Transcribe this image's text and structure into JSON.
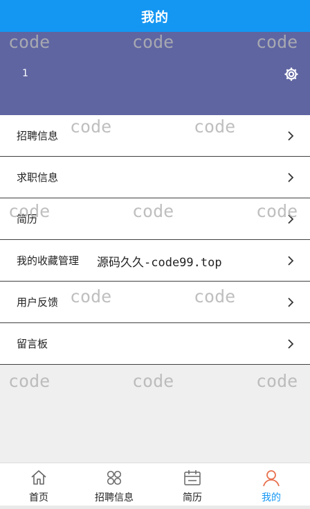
{
  "header": {
    "title": "我的"
  },
  "profile": {
    "username": "1",
    "settings_icon": "gear-icon"
  },
  "menu": {
    "items": [
      {
        "label": "招聘信息",
        "icon": "chevron-right-icon"
      },
      {
        "label": "求职信息",
        "icon": "chevron-right-icon"
      },
      {
        "label": "简历",
        "icon": "chevron-right-icon"
      },
      {
        "label": "我的收藏管理",
        "icon": "chevron-right-icon"
      },
      {
        "label": "用户反馈",
        "icon": "chevron-right-icon"
      },
      {
        "label": "留言板",
        "icon": "chevron-right-icon"
      }
    ]
  },
  "tabbar": {
    "tabs": [
      {
        "label": "首页",
        "icon": "home-icon"
      },
      {
        "label": "招聘信息",
        "icon": "grid-icon"
      },
      {
        "label": "简历",
        "icon": "calendar-icon"
      },
      {
        "label": "我的",
        "icon": "user-icon",
        "active": true
      }
    ]
  },
  "watermark": {
    "text": "code",
    "site": "源码久久-code99.top"
  },
  "colors": {
    "primary": "#1497f3",
    "profile_bg": "#5f65a1",
    "user_icon": "#e8714e"
  }
}
